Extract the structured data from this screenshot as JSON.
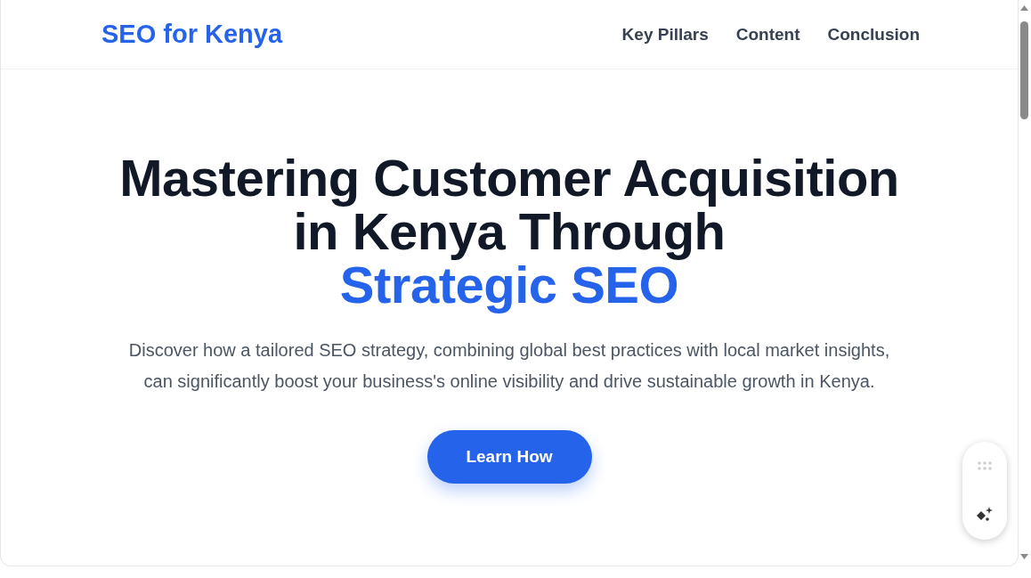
{
  "header": {
    "logo": "SEO for Kenya",
    "nav": [
      "Key Pillars",
      "Content",
      "Conclusion"
    ]
  },
  "hero": {
    "title": "Mastering Customer Acquisition in Kenya Through",
    "title_highlight": "Strategic SEO",
    "description": "Discover how a tailored SEO strategy, combining global best practices with local market insights, can significantly boost your business's online visibility and drive sustainable growth in Kenya.",
    "button": "Learn How"
  }
}
